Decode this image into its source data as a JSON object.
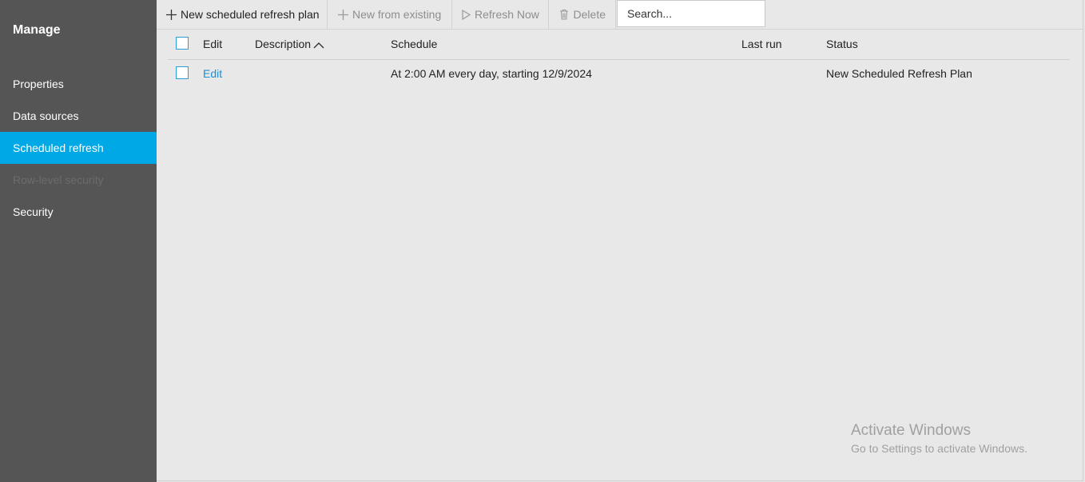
{
  "sidebar": {
    "title": "Manage",
    "items": [
      {
        "label": "Properties"
      },
      {
        "label": "Data sources"
      },
      {
        "label": "Scheduled refresh"
      },
      {
        "label": "Row-level security"
      },
      {
        "label": "Security"
      }
    ],
    "active_item": "Scheduled refresh",
    "colors": {
      "background": "#555555",
      "active": "#00a8e6",
      "disabled_text": "#6c6c6c"
    }
  },
  "toolbar": {
    "new_plan_label": "New scheduled refresh plan",
    "new_from_existing_label": "New from existing",
    "refresh_now_label": "Refresh Now",
    "delete_label": "Delete",
    "search_placeholder": "Search..."
  },
  "table": {
    "columns": [
      "Edit",
      "Description",
      "Schedule",
      "Last run",
      "Status"
    ],
    "sort_column": "Description",
    "sort_direction": "ascending",
    "rows": [
      {
        "edit": "Edit",
        "description": "",
        "schedule": "At 2:00 AM every day, starting 12/9/2024",
        "last_run": "",
        "status": "New Scheduled Refresh Plan"
      }
    ]
  },
  "watermark": {
    "title": "Activate Windows",
    "subtitle": "Go to Settings to activate Windows."
  },
  "colors": {
    "accent": "#00a8e6",
    "link": "#1a8fd4",
    "checkbox_border": "#2a9fd6"
  }
}
